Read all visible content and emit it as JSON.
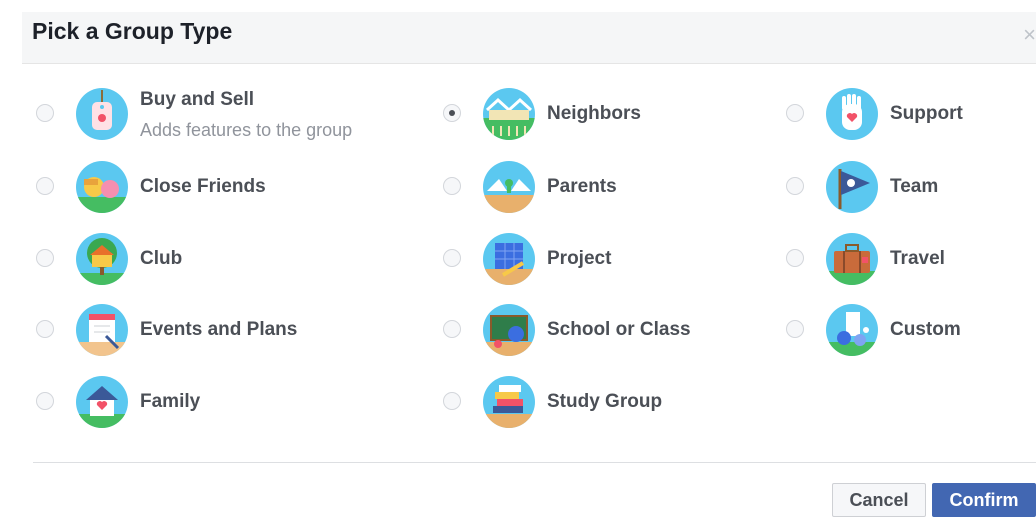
{
  "dialog": {
    "title": "Pick a Group Type",
    "close_glyph": "×"
  },
  "options": [
    {
      "label": "Buy and Sell",
      "sublabel": "Adds features to the group",
      "icon": "price-tag-icon",
      "selected": false
    },
    {
      "label": "Close Friends",
      "icon": "close-friends-icon",
      "selected": false
    },
    {
      "label": "Club",
      "icon": "treehouse-icon",
      "selected": false
    },
    {
      "label": "Events and Plans",
      "icon": "calendar-icon",
      "selected": false
    },
    {
      "label": "Family",
      "icon": "house-heart-icon",
      "selected": false
    },
    {
      "label": "Neighbors",
      "icon": "neighborhood-icon",
      "selected": true
    },
    {
      "label": "Parents",
      "icon": "parents-icon",
      "selected": false
    },
    {
      "label": "Project",
      "icon": "blueprint-icon",
      "selected": false
    },
    {
      "label": "School or Class",
      "icon": "chalkboard-icon",
      "selected": false
    },
    {
      "label": "Study Group",
      "icon": "books-icon",
      "selected": false
    },
    {
      "label": "Support",
      "icon": "hand-heart-icon",
      "selected": false
    },
    {
      "label": "Team",
      "icon": "pennant-flag-icon",
      "selected": false
    },
    {
      "label": "Travel",
      "icon": "suitcase-icon",
      "selected": false
    },
    {
      "label": "Custom",
      "icon": "custom-icon",
      "selected": false
    }
  ],
  "footer": {
    "cancel_label": "Cancel",
    "confirm_label": "Confirm"
  },
  "colors": {
    "accent": "#4267b2",
    "icon_background": "#5bc8f0",
    "grass": "#45bd62"
  }
}
